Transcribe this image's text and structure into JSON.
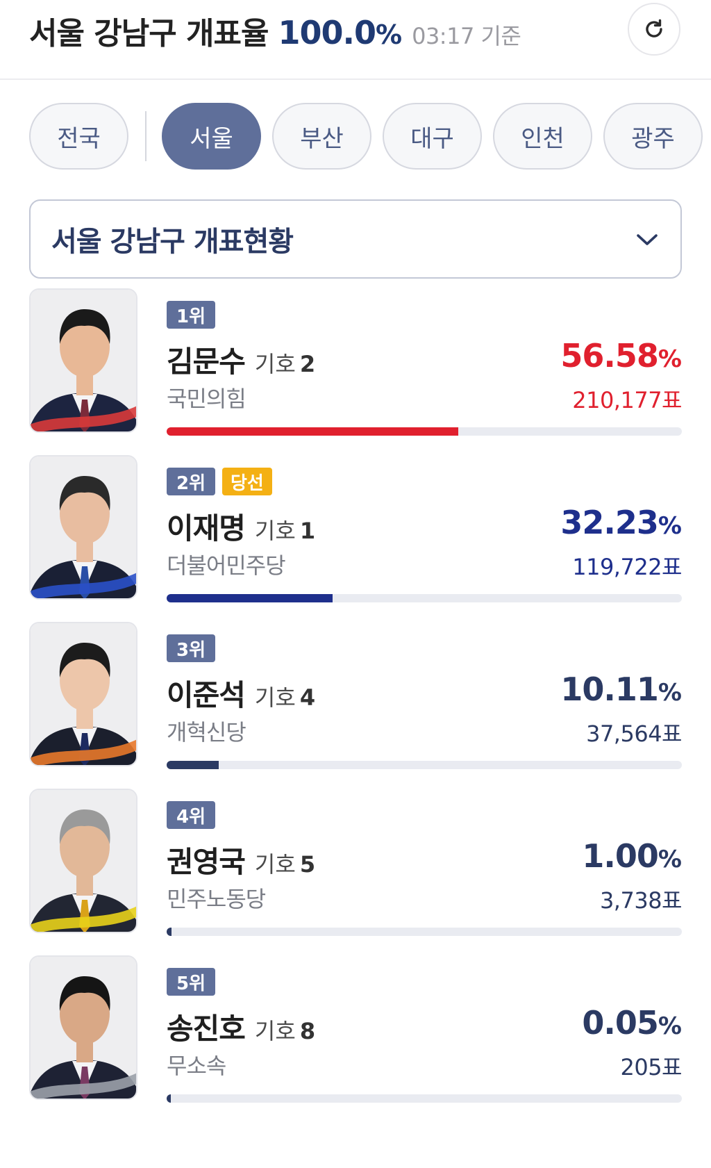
{
  "header": {
    "region_title": "서울 강남구 개표율",
    "rate": "100.0",
    "rate_unit": "%",
    "time": "03:17 기준",
    "refresh_icon": "refresh-icon"
  },
  "tabs": [
    {
      "label": "전국",
      "active": false
    },
    {
      "label": "서울",
      "active": true
    },
    {
      "label": "부산",
      "active": false
    },
    {
      "label": "대구",
      "active": false
    },
    {
      "label": "인천",
      "active": false
    },
    {
      "label": "광주",
      "active": false
    }
  ],
  "dropdown": {
    "label": "서울 강남구 개표현황",
    "icon": "chevron-down-icon"
  },
  "candidate_number_label": "기호",
  "elected_badge": "당선",
  "percent_unit": "%",
  "votes_unit": "표",
  "candidates": [
    {
      "rank": "1위",
      "name": "김문수",
      "number": "2",
      "party": "국민의힘",
      "percent": "56.58",
      "votes": "210,177표",
      "color": "#e0202e",
      "share": 0.5658,
      "elected": false,
      "skin": "#e8b896",
      "hair": "#1a1a1a",
      "suit": "#1d2440",
      "tie": "#7a2b3a",
      "ribbon": "#d83a3a"
    },
    {
      "rank": "2위",
      "name": "이재명",
      "number": "1",
      "party": "더불어민주당",
      "percent": "32.23",
      "votes": "119,722표",
      "color": "#1e2f8c",
      "share": 0.3223,
      "elected": true,
      "skin": "#e8bda0",
      "hair": "#2a2a2a",
      "suit": "#1a2035",
      "tie": "#2a4ea6",
      "ribbon": "#2a50c8"
    },
    {
      "rank": "3위",
      "name": "이준석",
      "number": "4",
      "party": "개혁신당",
      "percent": "10.11",
      "votes": "37,564표",
      "color": "#2b3a63",
      "share": 0.1011,
      "elected": false,
      "skin": "#edc6aa",
      "hair": "#1c1c1c",
      "suit": "#1b1f2d",
      "tie": "#1d2a60",
      "ribbon": "#e8782a"
    },
    {
      "rank": "4위",
      "name": "권영국",
      "number": "5",
      "party": "민주노동당",
      "percent": "1.00",
      "votes": "3,738표",
      "color": "#2b3a63",
      "share": 0.01,
      "elected": false,
      "skin": "#e2b898",
      "hair": "#9a9a9a",
      "suit": "#222633",
      "tie": "#d9a21a",
      "ribbon": "#e8d21a"
    },
    {
      "rank": "5위",
      "name": "송진호",
      "number": "8",
      "party": "무소속",
      "percent": "0.05",
      "votes": "205표",
      "color": "#2b3a63",
      "share": 0.0005,
      "elected": false,
      "skin": "#d9a886",
      "hair": "#151515",
      "suit": "#1e2234",
      "tie": "#7a3a62",
      "ribbon": "#9aa0a8"
    }
  ]
}
